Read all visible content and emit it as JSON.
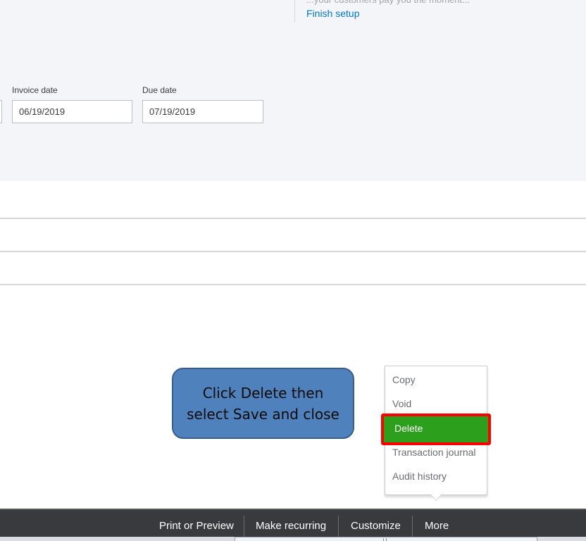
{
  "setup_panel": {
    "cutoff_text": "...your customers pay you the moment...",
    "finish_setup_link": "Finish setup"
  },
  "fields": {
    "invoice_date": {
      "label": "Invoice date",
      "value": "06/19/2019"
    },
    "due_date": {
      "label": "Due date",
      "value": "07/19/2019"
    }
  },
  "callout": {
    "line1": "Click Delete then",
    "line2": "select Save and close",
    "fill_color": "#4f81bd"
  },
  "more_menu": {
    "items": [
      "Copy",
      "Void",
      "Delete",
      "Transaction journal",
      "Audit history"
    ],
    "highlighted_item": "Delete",
    "highlight_color": "#2ca01c",
    "outline_color": "#ff0000"
  },
  "footer": {
    "buttons": [
      "Print or Preview",
      "Make recurring",
      "Customize",
      "More"
    ]
  }
}
